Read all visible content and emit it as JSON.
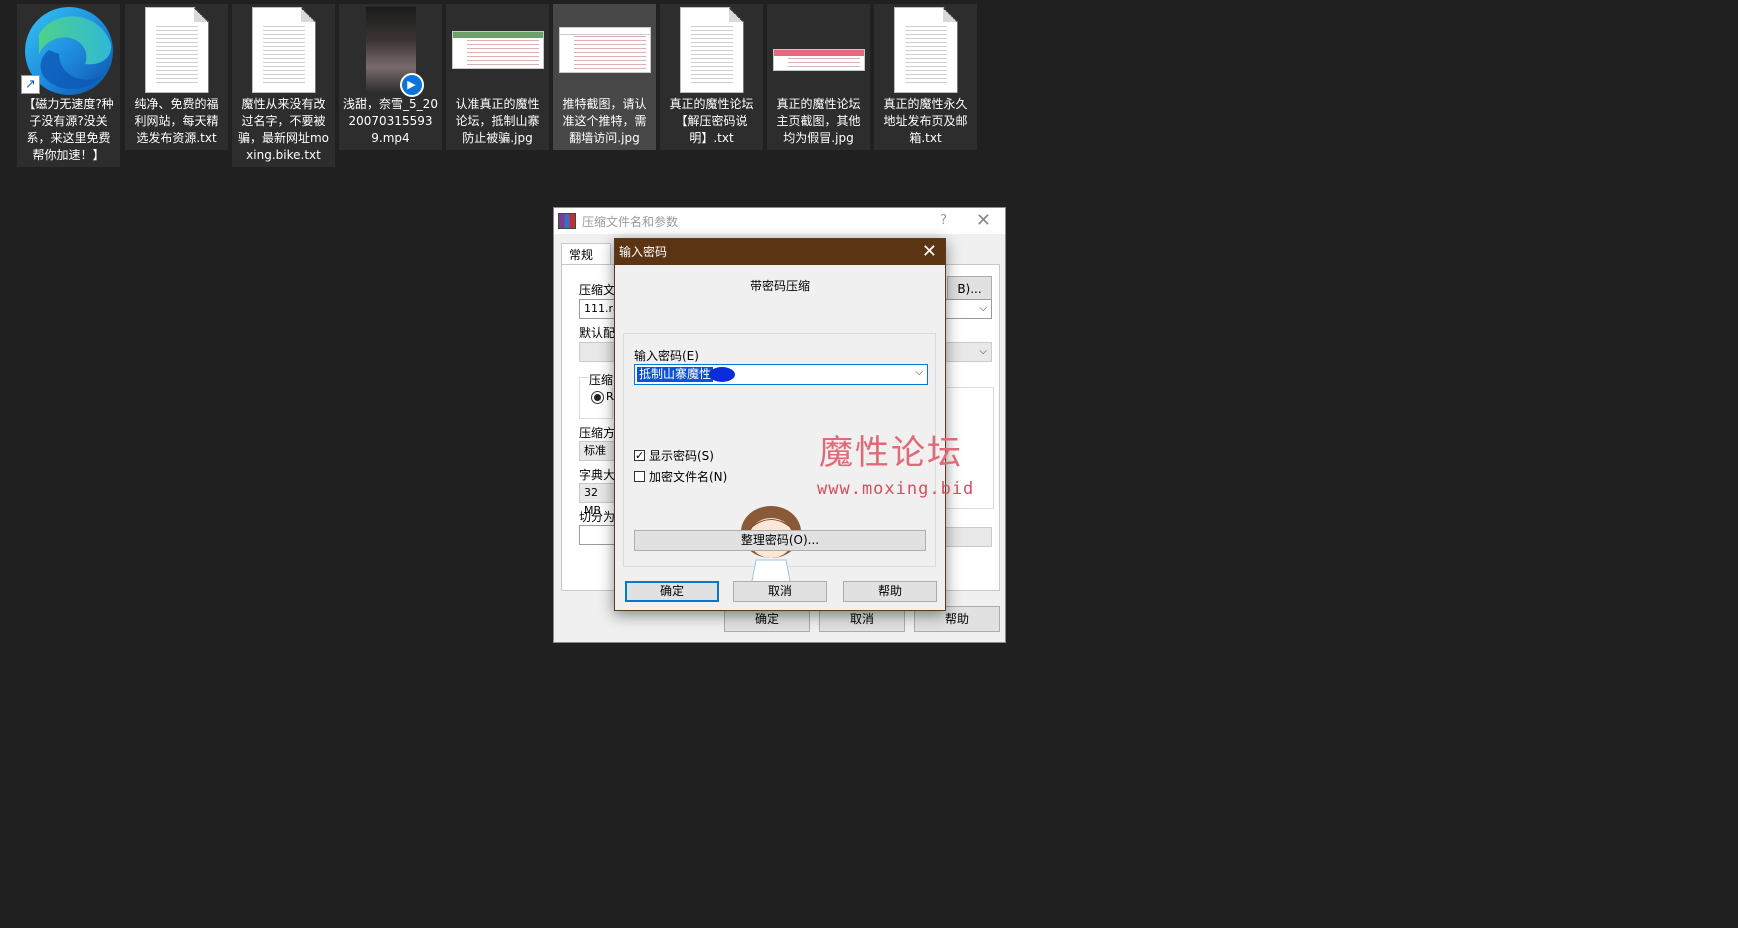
{
  "desktop": {
    "files": [
      {
        "label": "【磁力无速度?种子没有源?没关系，来这里免费帮你加速！】",
        "icon": "edge-shortcut-icon"
      },
      {
        "label": "纯净、免费的福利网站，每天精选发布资源.txt",
        "icon": "text-file-icon"
      },
      {
        "label": "魔性从来没有改过名字，不要被骗，最新网址moxing.bike.txt",
        "icon": "text-file-icon"
      },
      {
        "label": "浅甜，奈雪_5_20200703155939.mp4",
        "icon": "video-file-icon"
      },
      {
        "label": "认准真正的魔性论坛，抵制山寨防止被骗.jpg",
        "icon": "image-file-icon"
      },
      {
        "label": "推特截图，请认准这个推特，需翻墙访问.jpg",
        "icon": "image-file-icon"
      },
      {
        "label": "真正的魔性论坛【解压密码说明】.txt",
        "icon": "text-file-icon"
      },
      {
        "label": "真正的魔性论坛主页截图，其他均为假冒.jpg",
        "icon": "image-file-icon"
      },
      {
        "label": "真正的魔性永久地址发布页及邮箱.txt",
        "icon": "text-file-icon"
      }
    ]
  },
  "archive_dialog": {
    "title": "压缩文件名和参数",
    "help": "?",
    "close": "✕",
    "tab": "常规",
    "archive_name_label": "压缩文",
    "archive_name_value": "111.ra",
    "browse_btn": "B)...",
    "profile_label": "默认配",
    "format_label": "压缩",
    "format_rar": "RA",
    "method_label": "压缩方",
    "method_value": "标准",
    "dict_label": "字典大",
    "dict_value": "32 MB",
    "split_label": "切分为",
    "ok": "确定",
    "cancel": "取消",
    "help_btn": "帮助"
  },
  "password_dialog": {
    "title": "输入密码",
    "close": "✕",
    "heading": "带密码压缩",
    "password_label": "输入密码(E)",
    "password_value": "抵制山寨魔性",
    "show_password": {
      "label": "显示密码(S)",
      "checked": true,
      "mark": "✓"
    },
    "encrypt_names": {
      "label": "加密文件名(N)",
      "checked": false
    },
    "manage_btn": "整理密码(O)...",
    "ok": "确定",
    "cancel": "取消",
    "help": "帮助"
  },
  "watermark": {
    "title": "魔性论坛",
    "url": "www.moxing.bid"
  },
  "colors": {
    "desktop_bg": "#202020",
    "password_titlebar": "#5b3513",
    "selection": "#0a53d6",
    "watermark": "#e06a78"
  }
}
